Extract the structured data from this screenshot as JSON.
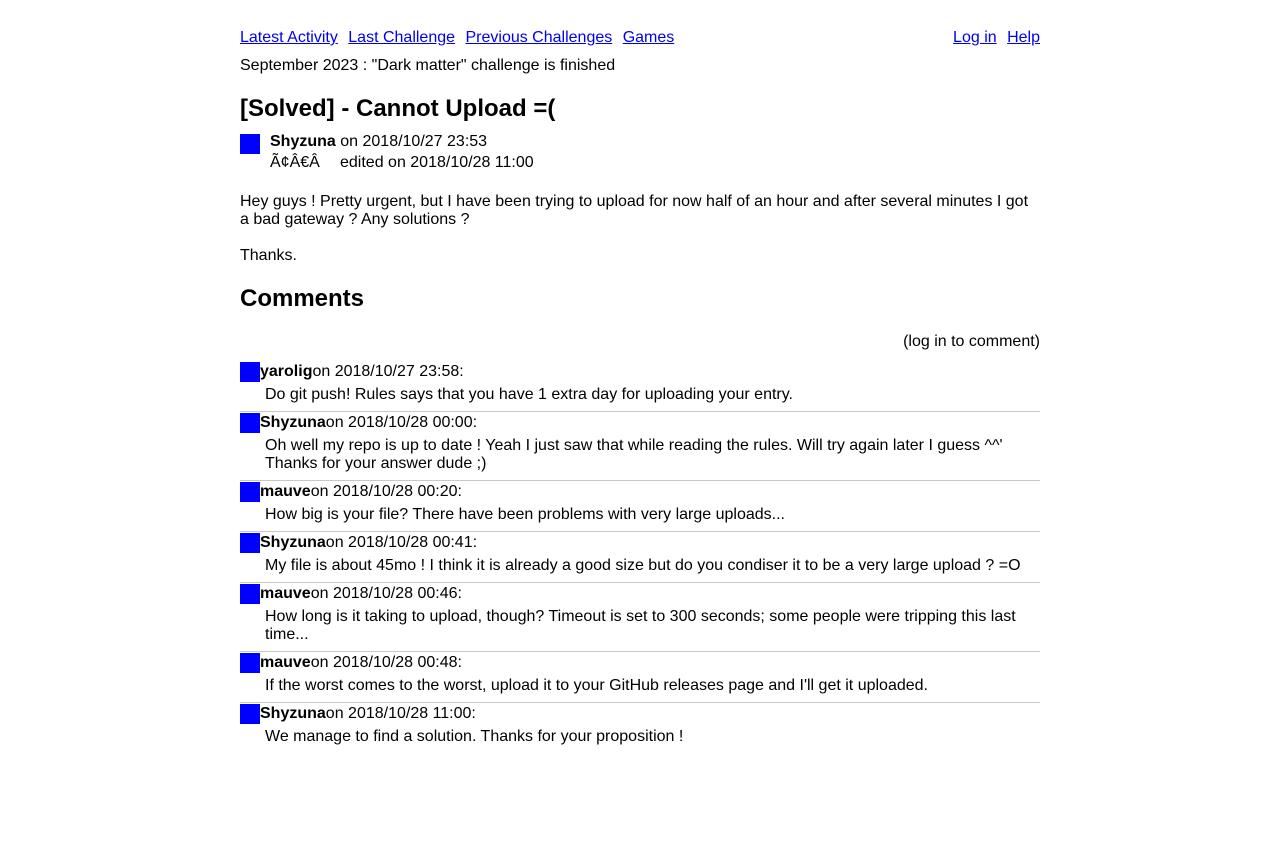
{
  "nav": {
    "left": [
      "Latest Activity",
      "Last Challenge",
      "Previous Challenges",
      "Games"
    ],
    "right": [
      "Log in",
      "Help"
    ]
  },
  "announcement": "September 2023 : \"Dark matter\" challenge is finished",
  "post": {
    "title": "[Solved] - Cannot Upload =(",
    "author": "Shyzuna",
    "posted": "on 2018/10/27 23:53",
    "garbled": "Ã¢Â€Â",
    "edited": "edited on 2018/10/28 11:00",
    "paragraphs": [
      "Hey guys ! Pretty urgent, but I have been trying to upload for now half of an hour and after several minutes I got a bad gateway ? Any solutions ?",
      "Thanks."
    ]
  },
  "comments_heading": "Comments",
  "login_note": "(log in to comment)",
  "comments": [
    {
      "user": "yarolig",
      "when": "on 2018/10/27 23:58:",
      "text": "Do git push! Rules says that you have 1 extra day for uploading your entry."
    },
    {
      "user": "Shyzuna",
      "when": "on 2018/10/28 00:00:",
      "text": "Oh well my repo is up to date ! Yeah I just saw that while reading the rules. Will try again later I guess ^^' Thanks for your answer dude ;)"
    },
    {
      "user": "mauve",
      "when": "on 2018/10/28 00:20:",
      "text": "How big is your file? There have been problems with very large uploads..."
    },
    {
      "user": "Shyzuna",
      "when": "on 2018/10/28 00:41:",
      "text": "My file is about 45mo ! I think it is already a good size but do you condiser it to be a very large upload ? =O"
    },
    {
      "user": "mauve",
      "when": "on 2018/10/28 00:46:",
      "text": "How long is it taking to upload, though? Timeout is set to 300 seconds; some people were tripping this last time..."
    },
    {
      "user": "mauve",
      "when": "on 2018/10/28 00:48:",
      "text": "If the worst comes to the worst, upload it to your GitHub releases page and I'll get it uploaded."
    },
    {
      "user": "Shyzuna",
      "when": "on 2018/10/28 11:00:",
      "text": "We manage to find a solution. Thanks for your proposition !"
    }
  ],
  "colors": {
    "avatar": "#0000ff",
    "link": "#0000ee",
    "separator": "#c8c8c8"
  }
}
